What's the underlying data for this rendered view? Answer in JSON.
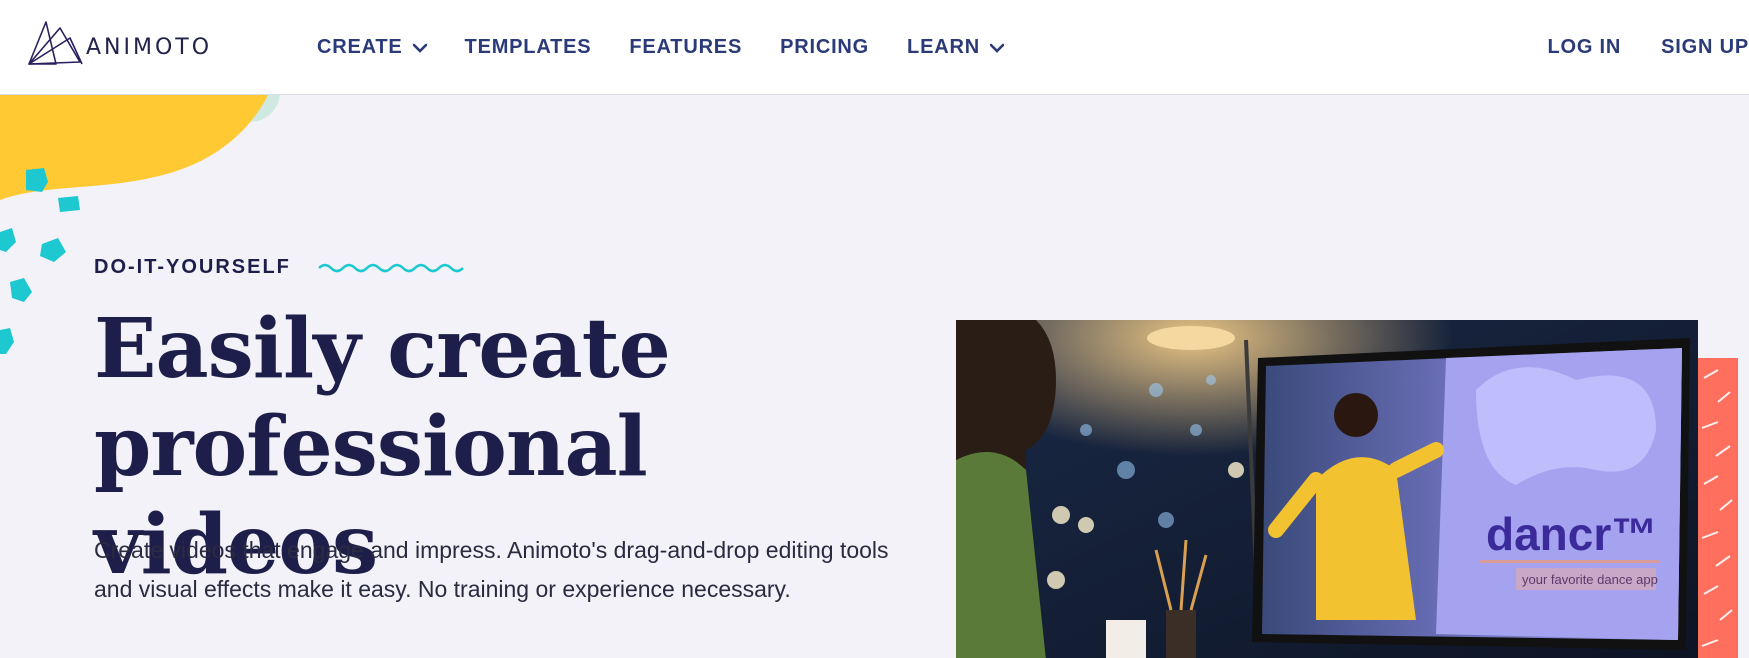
{
  "nav": {
    "logo_text": "ANIMOTO",
    "items": [
      {
        "label": "CREATE",
        "has_dropdown": true
      },
      {
        "label": "TEMPLATES",
        "has_dropdown": false
      },
      {
        "label": "FEATURES",
        "has_dropdown": false
      },
      {
        "label": "PRICING",
        "has_dropdown": false
      },
      {
        "label": "LEARN",
        "has_dropdown": true
      }
    ],
    "login_label": "LOG IN",
    "signup_label": "SIGN UP"
  },
  "hero": {
    "eyebrow": "DO-IT-YOURSELF",
    "headline_line1": "Easily create",
    "headline_line2": "professional videos",
    "subcopy": "Create videos that engage and impress. Animoto's drag-and-drop editing tools and visual effects make it easy. No training or experience necessary.",
    "image": {
      "screen_brand": "dancr™",
      "screen_tagline": "your favorite dance app"
    }
  },
  "colors": {
    "nav_text": "#2b3a78",
    "headline": "#1d1f4a",
    "background": "#f2f2f8",
    "yellow_blob": "#ffc933",
    "teal_accent": "#1ec8d0",
    "pink_dots": "#e8467c",
    "coral": "#ff6f5e"
  }
}
